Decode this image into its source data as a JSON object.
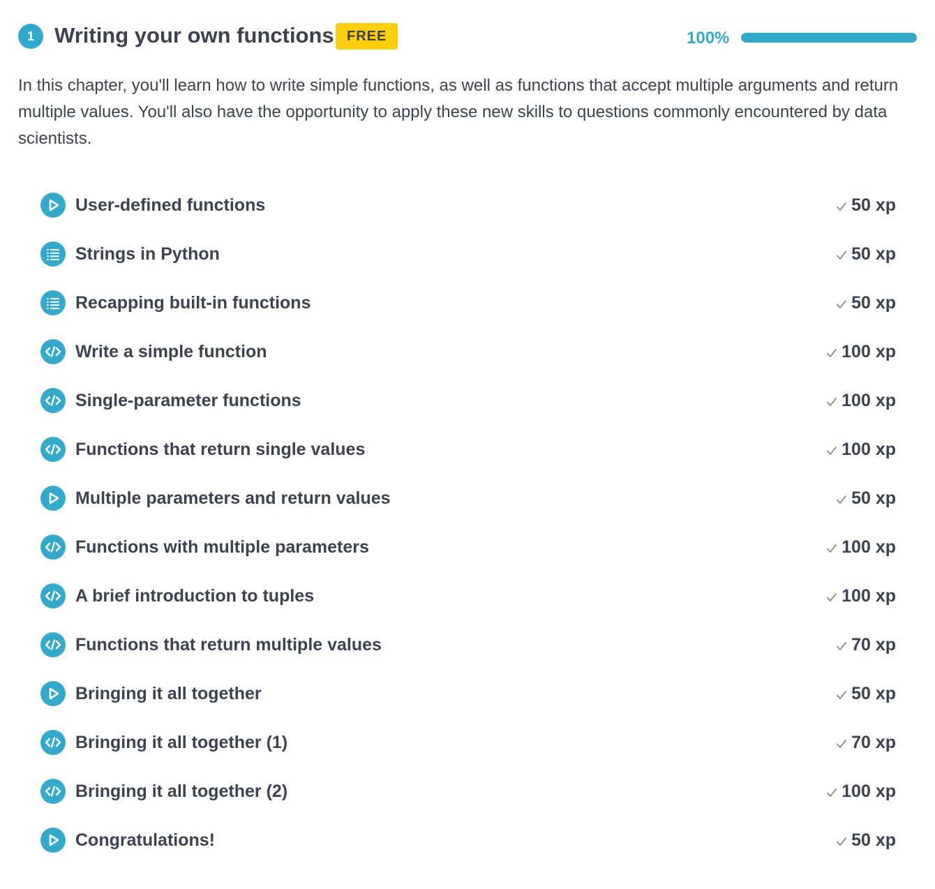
{
  "chapter": {
    "number": "1",
    "title": "Writing your own functions",
    "badge": "FREE",
    "progress_label": "100%",
    "progress": 1.0,
    "description": "In this chapter, you'll learn how to write simple functions, as well as functions that accept multiple arguments and return multiple values. You'll also have the opportunity to apply these new skills to questions commonly encountered by data scientists."
  },
  "colors": {
    "accent": "#33aacc",
    "badge": "#fcce0d",
    "text": "#3d4251",
    "check": "#8d919b"
  },
  "exercises": [
    {
      "type": "video-play-icon",
      "title": "User-defined functions",
      "xp": "50 xp"
    },
    {
      "type": "multiple-choice-list-icon",
      "title": "Strings in Python",
      "xp": "50 xp"
    },
    {
      "type": "multiple-choice-list-icon",
      "title": "Recapping built-in functions",
      "xp": "50 xp"
    },
    {
      "type": "code-icon",
      "title": "Write a simple function",
      "xp": "100 xp"
    },
    {
      "type": "code-icon",
      "title": "Single-parameter functions",
      "xp": "100 xp"
    },
    {
      "type": "code-icon",
      "title": "Functions that return single values",
      "xp": "100 xp"
    },
    {
      "type": "video-play-icon",
      "title": "Multiple parameters and return values",
      "xp": "50 xp"
    },
    {
      "type": "code-icon",
      "title": "Functions with multiple parameters",
      "xp": "100 xp"
    },
    {
      "type": "code-icon",
      "title": "A brief introduction to tuples",
      "xp": "100 xp"
    },
    {
      "type": "code-icon",
      "title": "Functions that return multiple values",
      "xp": "70 xp"
    },
    {
      "type": "video-play-icon",
      "title": "Bringing it all together",
      "xp": "50 xp"
    },
    {
      "type": "code-icon",
      "title": "Bringing it all together (1)",
      "xp": "70 xp"
    },
    {
      "type": "code-icon",
      "title": "Bringing it all together (2)",
      "xp": "100 xp"
    },
    {
      "type": "video-play-icon",
      "title": "Congratulations!",
      "xp": "50 xp"
    }
  ]
}
